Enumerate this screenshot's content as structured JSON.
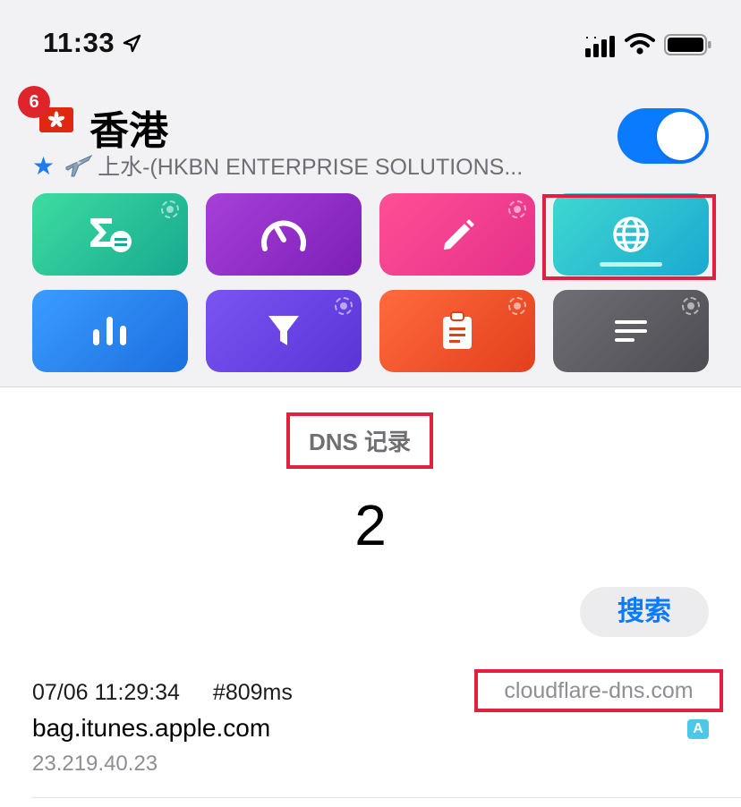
{
  "status_bar": {
    "time": "11:33",
    "icons": [
      "location-arrow-icon",
      "signal-icon",
      "wifi-icon",
      "battery-icon"
    ]
  },
  "header": {
    "badge_count": "6",
    "flag_icon": "hong-kong-flag-icon",
    "title": "香港",
    "subtitle": "上水-(HKBN ENTERPRISE SOLUTIONS...",
    "subtitle_icons": [
      "star-icon",
      "airplane-icon"
    ],
    "toggle_on": true
  },
  "tiles": [
    {
      "icon": "sigma-list-icon",
      "color": "#17a88f"
    },
    {
      "icon": "speedometer-icon",
      "color": "#7d1fb8"
    },
    {
      "icon": "pencil-icon",
      "color": "#e6308a"
    },
    {
      "icon": "globe-icon",
      "color": "#1aa9d1",
      "selected": true
    },
    {
      "icon": "bar-chart-icon",
      "color": "#1b6fe0"
    },
    {
      "icon": "filter-funnel-icon",
      "color": "#5a34d6"
    },
    {
      "icon": "clipboard-icon",
      "color": "#e2401c"
    },
    {
      "icon": "text-lines-icon",
      "color": "#4d4d52"
    }
  ],
  "section": {
    "title": "DNS 记录",
    "count": "2",
    "search_label": "搜索"
  },
  "records": [
    {
      "timestamp": "07/06 11:29:34",
      "duration": "#809ms",
      "server": "cloudflare-dns.com",
      "domain": "bag.itunes.apple.com",
      "ip": "23.219.40.23",
      "type": "A"
    }
  ],
  "colors": {
    "accent": "#0a7aff",
    "highlight": "#e0203c",
    "badge": "#e0242c"
  }
}
